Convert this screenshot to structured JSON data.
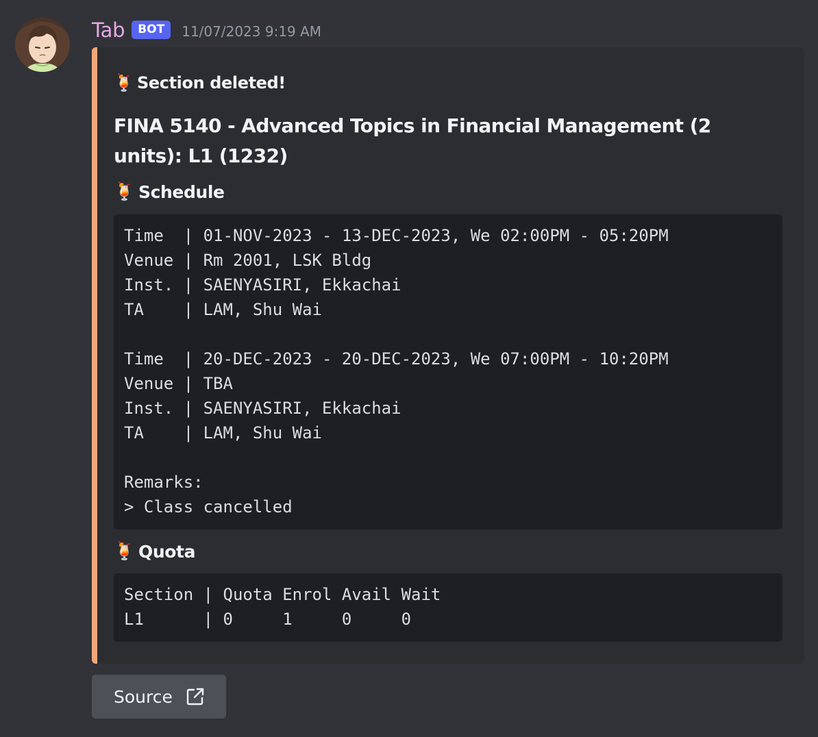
{
  "message": {
    "username": "Tab",
    "badge": "BOT",
    "timestamp": "11/07/2023 9:19 AM",
    "avatar": "anime-girl-avatar"
  },
  "embed": {
    "accent_color": "#f0a87a",
    "author_emoji": "🍹",
    "author": "Section deleted!",
    "title": "FINA 5140 - Advanced Topics in Financial Management (2 units): L1 (1232)",
    "fields": [
      {
        "emoji": "🍹",
        "name": "Schedule",
        "code": "Time  | 01-NOV-2023 - 13-DEC-2023, We 02:00PM - 05:20PM\nVenue | Rm 2001, LSK Bldg\nInst. | SAENYASIRI, Ekkachai\nTA    | LAM, Shu Wai\n\nTime  | 20-DEC-2023 - 20-DEC-2023, We 07:00PM - 10:20PM\nVenue | TBA\nInst. | SAENYASIRI, Ekkachai\nTA    | LAM, Shu Wai\n\nRemarks:\n> Class cancelled"
      },
      {
        "emoji": "🍹",
        "name": "Quota",
        "code": "Section | Quota Enrol Avail Wait\nL1      | 0     1     0     0"
      }
    ]
  },
  "button": {
    "label": "Source",
    "icon": "external-link-icon"
  }
}
